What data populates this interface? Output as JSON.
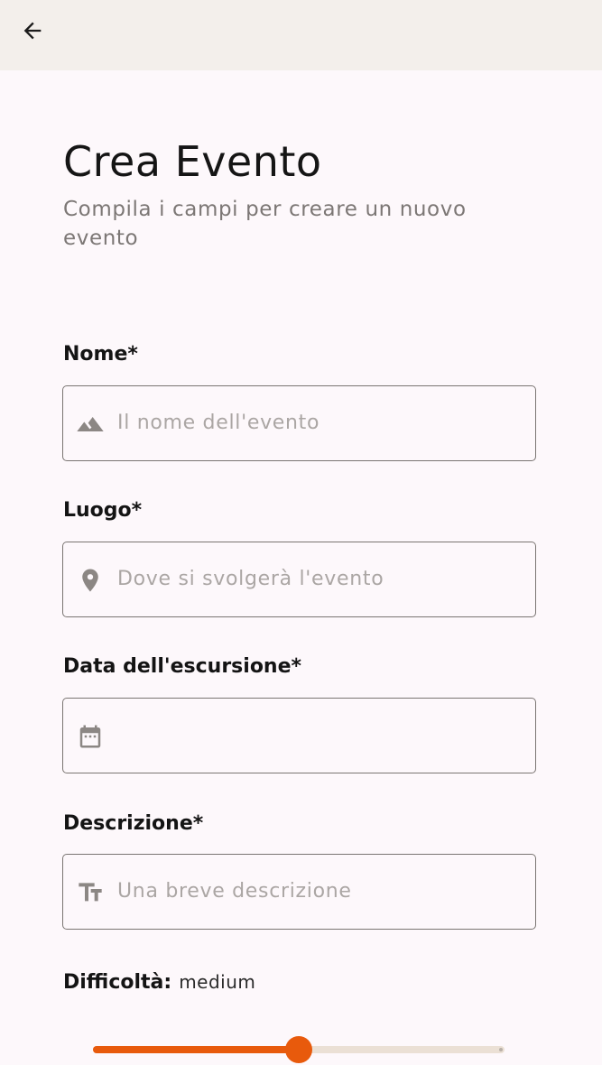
{
  "header": {
    "back_icon": "arrow-left-icon"
  },
  "page": {
    "title": "Crea Evento",
    "subtitle": "Compila i campi per creare un nuovo evento"
  },
  "form": {
    "name": {
      "label": "Nome*",
      "placeholder": "Il nome dell'evento",
      "value": "",
      "icon": "landscape-icon"
    },
    "place": {
      "label": "Luogo*",
      "placeholder": "Dove si svolgerà l'evento",
      "value": "",
      "icon": "location-pin-icon"
    },
    "date": {
      "label": "Data dell'escursione*",
      "placeholder": "",
      "value": "",
      "icon": "calendar-icon"
    },
    "description": {
      "label": "Descrizione*",
      "placeholder": "Una breve descrizione",
      "value": "",
      "icon": "text-fields-icon"
    },
    "difficulty": {
      "label": "Difficoltà:",
      "value": "medium",
      "slider_level": 0.5
    }
  },
  "colors": {
    "accent": "#e85a0c",
    "track": "#ebe0d5",
    "appbar": "#f3efeb",
    "background": "#fdf8fb"
  }
}
